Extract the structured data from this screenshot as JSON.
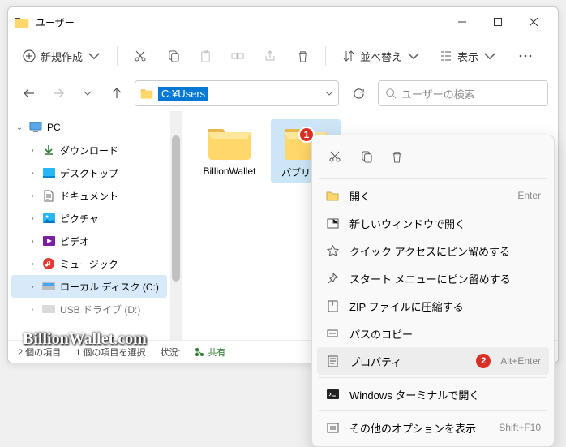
{
  "title": "ユーザー",
  "toolbar": {
    "new": "新規作成",
    "sort": "並べ替え",
    "view": "表示"
  },
  "address": {
    "path": "C:¥Users"
  },
  "search": {
    "placeholder": "ユーザーの検索"
  },
  "sidebar": {
    "pc": "PC",
    "downloads": "ダウンロード",
    "desktop": "デスクトップ",
    "documents": "ドキュメント",
    "pictures": "ピクチャ",
    "videos": "ビデオ",
    "music": "ミュージック",
    "localdisk": "ローカル ディスク (C:)",
    "usbdrive": "USB ドライブ (D:)"
  },
  "folders": {
    "a": "BillionWallet",
    "b": "パブリック"
  },
  "status": {
    "count": "2 個の項目",
    "selected": "1 個の項目を選択",
    "statelabel": "状況:",
    "share": "共有"
  },
  "context": {
    "open": "開く",
    "newwindow": "新しいウィンドウで開く",
    "quickpin": "クイック アクセスにピン留めする",
    "startpin": "スタート メニューにピン留めする",
    "zip": "ZIP ファイルに圧縮する",
    "copypath": "パスのコピー",
    "properties": "プロパティ",
    "terminal": "Windows ターミナルで開く",
    "moreoptions": "その他のオプションを表示",
    "sc_enter": "Enter",
    "sc_altenter": "Alt+Enter",
    "sc_shiftf10": "Shift+F10"
  },
  "badges": {
    "one": "1",
    "two": "2"
  },
  "watermark": "BillionWallet.com"
}
